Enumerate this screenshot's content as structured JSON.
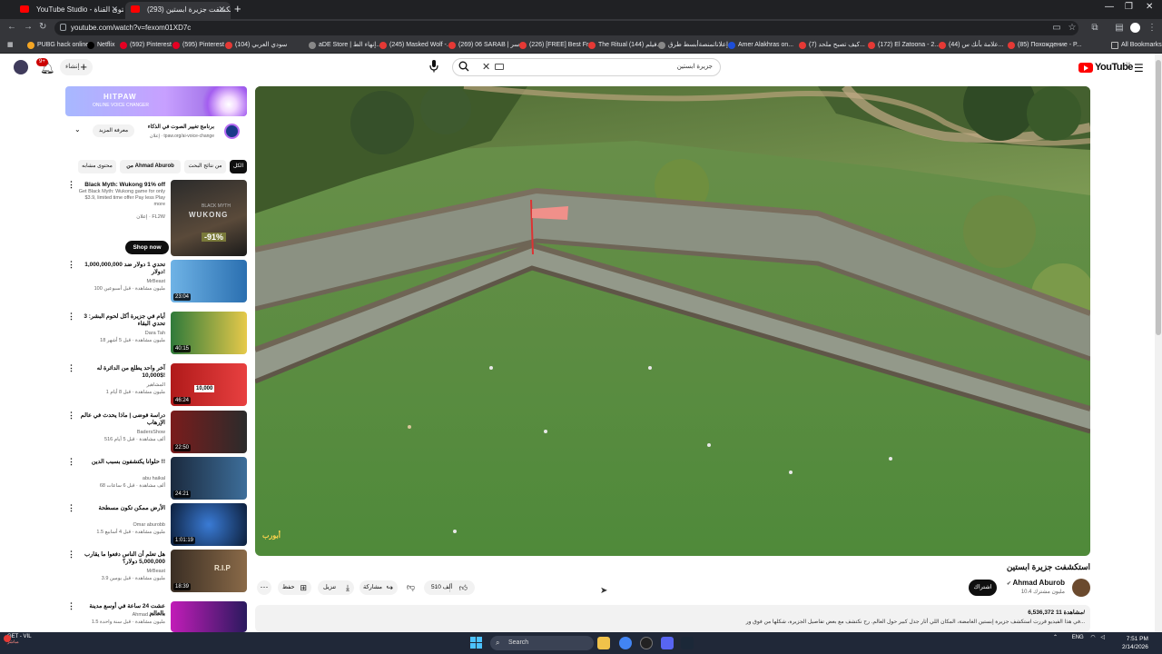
{
  "browser": {
    "tabs": [
      {
        "title": "YouTube Studio - محتوى القناة",
        "favicon_color": "#ff0000"
      },
      {
        "title": "(293) استكشفت جزيرة ابستين",
        "favicon_color": "#ff0000",
        "active": true
      }
    ],
    "url": "youtube.com/watch?v=fexom01XD7c",
    "bookmarks": [
      "PUBG hack online",
      "Netflix",
      "(592) Pinterest",
      "(595) Pinterest",
      "(104) سودي العربي",
      "aDE Store | إنهاء الط...",
      "(245) Masked Wolf -...",
      "(269) 06 SARAB | سر...",
      "(226) [FREE] Best Fr...",
      "The Ritual (144) فيلم...",
      "إعلاناتمنصةأبسط طرق...",
      "Amer Alakhras on...",
      "(7) كيف تصبح ملحد...",
      "(172) El Zatoona - 2...",
      "(44) علامة بأنك س...",
      "(85) Похождение - P...",
      "All Bookmarks"
    ]
  },
  "header": {
    "notification_count": "9+",
    "create_label": "إنشاء",
    "search_query": "جزيرة ابستين",
    "logo_text": "YouTube",
    "logo_sup": "SA"
  },
  "sidebar": {
    "ad_banner": {
      "brand": "HITPAW",
      "sub": "ONLINE VOICE CHANGER"
    },
    "ad_card": {
      "title": "برنامج تغيير الصوت في الذكاء",
      "url": "إعلان · tpaw.org/ai-voice-change",
      "more_label": "معرفة المزيد"
    },
    "chips": [
      "الكل",
      "من نتائج البحث",
      "من Ahmad Aburob",
      "محتوى مشابه"
    ],
    "items": [
      {
        "title": "Black Myth: Wukong 91% off",
        "channel": "Get Black Myth: Wukong game for only $3.9, limited time offer Pay less Play more",
        "meta": "إعلان · FL2W",
        "duration": "-91%",
        "action": "Shop now"
      },
      {
        "title": "تحدي 1 دولار ضد 1,000,000,000 دولار!",
        "channel": "MrBeast",
        "meta": "100 مليون مشاهدة · قبل أسبوعين",
        "duration": "23:04"
      },
      {
        "title": "3 أيام في جزيرة أكل لحوم البشر: تحدي البقاء",
        "channel": "Dara Tah",
        "meta": "18 مليون مشاهدة · قبل 5 أشهر",
        "duration": "40:15"
      },
      {
        "title": "آخر واحد يطلع من الدائرة له 10,000$!",
        "channel": "المشاهير",
        "meta": "1 مليون مشاهدة · قبل 8 أيام",
        "duration": "46:24"
      },
      {
        "title": "دراسة فوضى | ماذا يحدث في عالم الإرهاب",
        "channel": "BadersShow",
        "meta": "516 ألف مشاهدة · قبل 5 أيام",
        "duration": "22:50"
      },
      {
        "title": "حلوانا يكتشفون بسبب الدين !!",
        "channel": "abu haikal",
        "meta": "68 ألف مشاهدة · قبل 6 ساعات",
        "duration": "24:21"
      },
      {
        "title": "الأرض ممكن تكون مسطحة",
        "channel": "Omar aburobb",
        "meta": "1.5 مليون مشاهدة · قبل 4 أسابيع",
        "duration": "1:01:19"
      },
      {
        "title": "هل تعلم أن الناس دفعوا ما يقارب 5,000,000 دولار؟",
        "channel": "MrBeast",
        "meta": "3.9 مليون مشاهدة · قبل يومين",
        "duration": "18:39"
      },
      {
        "title": "عشت 24 ساعة في أوسع مدينة بالعالم",
        "channel": "Ahmad Aburob",
        "meta": "1.5 مليون مشاهدة · قبل سنة واحدة",
        "duration": ""
      }
    ]
  },
  "video": {
    "watermark": "أبورب",
    "title": "استكشفت جزيرة ابستين",
    "channel": "Ahmad Aburob",
    "subscribers": "10.4 مليون مشترك",
    "subscribe_label": "اشتراك",
    "likes": "510 ألف",
    "share_label": "مشاركة",
    "download_label": "تنزيل",
    "save_label": "حفظ",
    "views": "6,536,372 مشاهدة",
    "date": "11/",
    "description": "في هذا الفيديو قررت استكشف جزيرة إبستين الغامضة، المكان اللي أثار جدل كبير حول العالم. رح نكتشف مع بعض تفاصيل الجزيرة، شكلها من فوق ور..."
  },
  "taskbar": {
    "weather": "GET - VIL",
    "weather_sub": "مباشر",
    "search_placeholder": "Search",
    "lang": "ENG",
    "time": "7:51 PM",
    "date": "2/14/2026"
  }
}
